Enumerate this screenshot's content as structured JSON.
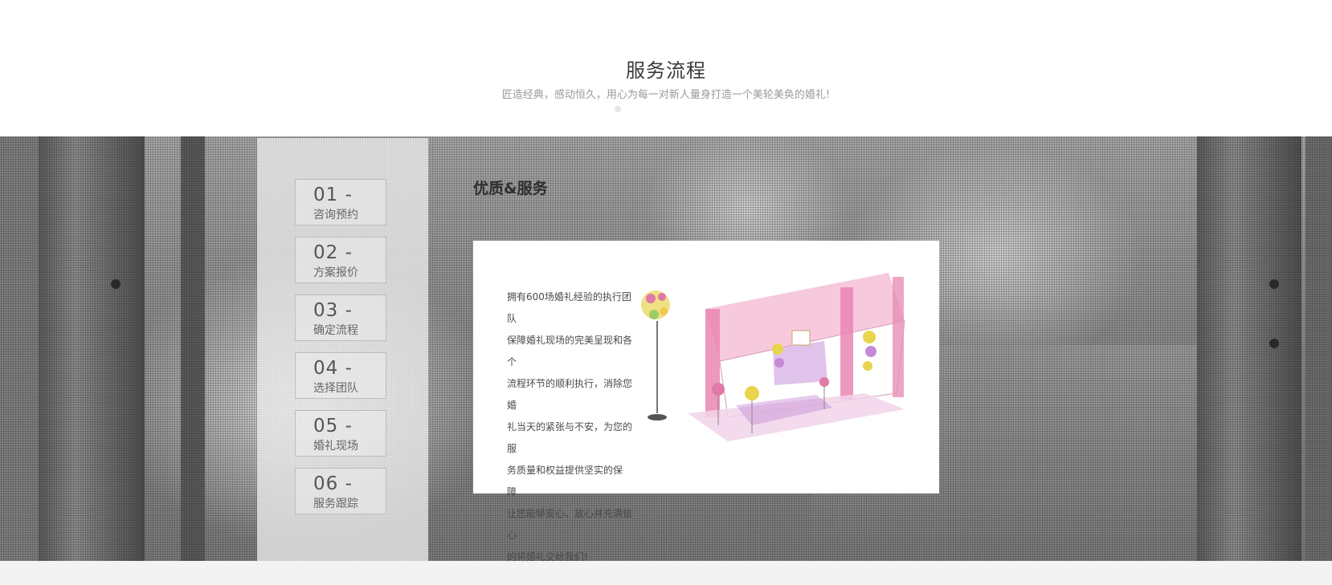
{
  "header": {
    "title": "服务流程",
    "subtitle": "匠造经典，感动恒久，用心为每一对新人量身打造一个美轮美奂的婚礼!"
  },
  "steps": [
    {
      "num": "01 -",
      "label": "咨询预约"
    },
    {
      "num": "02 -",
      "label": "方案报价"
    },
    {
      "num": "03 -",
      "label": "确定流程"
    },
    {
      "num": "04 -",
      "label": "选择团队"
    },
    {
      "num": "05 -",
      "label": "婚礼现场"
    },
    {
      "num": "06 -",
      "label": "服务跟踪"
    }
  ],
  "content": {
    "heading": "优质&服务",
    "lines": [
      "拥有600场婚礼经验的执行团",
      "队",
      "保障婚礼现场的完美呈现和各",
      "个",
      "流程环节的顺利执行，消除您",
      "婚",
      "礼当天的紧张与不安，为您的",
      "服",
      "务质量和权益提供坚实的保",
      "障",
      "让您能够安心、放心并充满信",
      "心",
      "的将婚礼交给我们!"
    ],
    "image_icon": "wedding-stage-sketch"
  },
  "colors": {
    "title": "#3a3a3a",
    "subtitle": "#9a9a9a",
    "panel": "#ececec",
    "card": "#ffffff",
    "accent_pink": "#e07aa8"
  }
}
